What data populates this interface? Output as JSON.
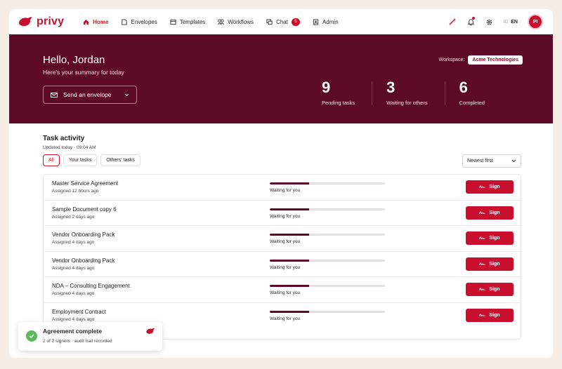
{
  "brand": {
    "name": "privy",
    "color": "#c8102e"
  },
  "nav": {
    "items": [
      {
        "label": "Home",
        "icon": "home-icon",
        "active": true
      },
      {
        "label": "Envelopes",
        "icon": "envelope-icon"
      },
      {
        "label": "Templates",
        "icon": "template-icon"
      },
      {
        "label": "Workflows",
        "icon": "workflow-icon"
      },
      {
        "label": "Chat",
        "icon": "chat-icon",
        "badge": "5"
      },
      {
        "label": "Admin",
        "icon": "admin-icon"
      }
    ],
    "lang_off": "ID",
    "lang_on": "EN",
    "avatar": "PI"
  },
  "hero": {
    "greeting": "Hello, Jordan",
    "subtitle": "Here's your summary for today",
    "send_button": "Send an envelope",
    "workspace_label": "Workspace:",
    "workspace_name": "Acme Technologies",
    "stats": [
      {
        "value": "9",
        "label": "Pending tasks"
      },
      {
        "value": "3",
        "label": "Waiting for others"
      },
      {
        "value": "6",
        "label": "Completed"
      }
    ]
  },
  "activity": {
    "title": "Task activity",
    "updated": "Updated today · 09:04 AM",
    "filters": [
      "All",
      "Your tasks",
      "Others' tasks"
    ],
    "sort": "Newest first",
    "tasks": [
      {
        "name": "Master Service Agreement",
        "assigned": "Assigned 12 hours ago",
        "status": "Waiting for you",
        "progress": 0.34,
        "action": "Sign"
      },
      {
        "name": "Sample Document copy 6",
        "assigned": "Assigned 2 days ago",
        "status": "Waiting for you",
        "progress": 0.34,
        "action": "Sign"
      },
      {
        "name": "Vendor Onboarding Pack",
        "assigned": "Assigned 4 days ago",
        "status": "Waiting for you",
        "progress": 0.34,
        "action": "Sign"
      },
      {
        "name": "Vendor Onboarding Pack",
        "assigned": "Assigned 4 days ago",
        "status": "Waiting for you",
        "progress": 0.34,
        "action": "Sign"
      },
      {
        "name": "NDA – Consulting Engagement",
        "assigned": "Assigned 4 days ago",
        "status": "Waiting for you",
        "progress": 0.34,
        "action": "Sign"
      },
      {
        "name": "Employment Contract",
        "assigned": "Assigned 4 days ago",
        "status": "Waiting for you",
        "progress": 0.34,
        "action": "Sign"
      }
    ]
  },
  "toast": {
    "title": "Agreement complete",
    "subtitle": "2 of 2 signers · audit trail recorded"
  }
}
